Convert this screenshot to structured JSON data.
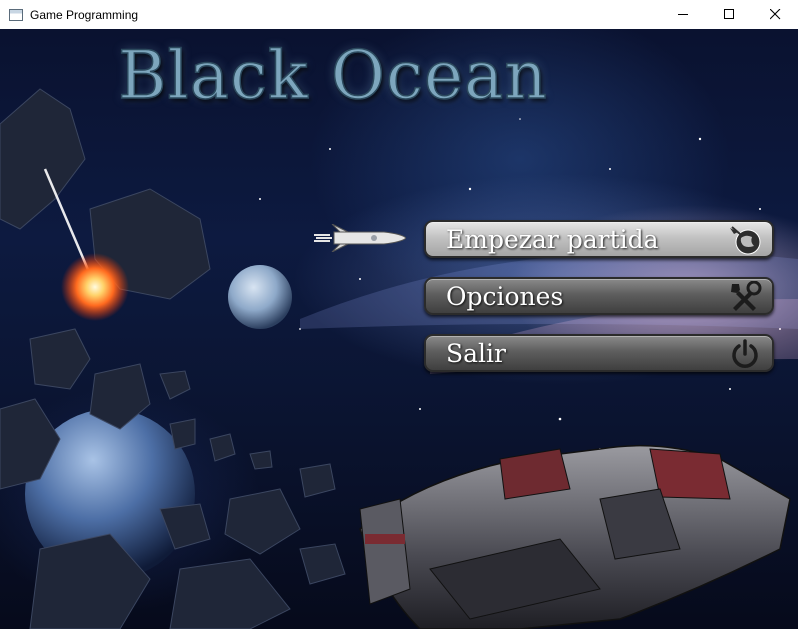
{
  "window": {
    "title": "Game Programming"
  },
  "game": {
    "title": "Black Ocean",
    "menu": [
      {
        "label": "Empezar partida",
        "icon": "globe-comet-icon",
        "selected": true
      },
      {
        "label": "Opciones",
        "icon": "tools-icon",
        "selected": false
      },
      {
        "label": "Salir",
        "icon": "power-icon",
        "selected": false
      }
    ],
    "selection_indicator": "rocket-icon"
  },
  "colors": {
    "title_fill": "#7da6bd",
    "button_selected": "#c2c2c2",
    "button_normal": "#5e5e5e",
    "button_text": "#ffffff"
  }
}
